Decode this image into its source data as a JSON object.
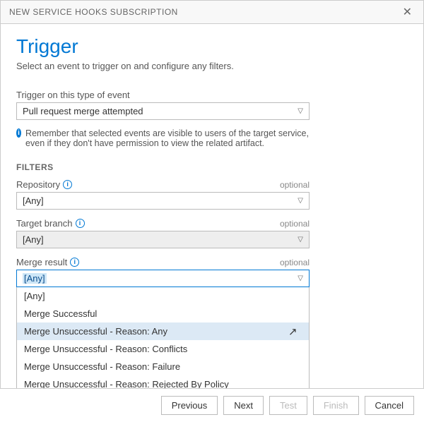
{
  "titlebar": {
    "title": "NEW SERVICE HOOKS SUBSCRIPTION"
  },
  "header": {
    "title": "Trigger",
    "subtitle": "Select an event to trigger on and configure any filters."
  },
  "event": {
    "label": "Trigger on this type of event",
    "value": "Pull request merge attempted"
  },
  "note": "Remember that selected events are visible to users of the target service, even if they don't have permission to view the related artifact.",
  "filters": {
    "heading": "FILTERS",
    "optional": "optional",
    "repository": {
      "label": "Repository",
      "value": "[Any]"
    },
    "branch": {
      "label": "Target branch",
      "value": "[Any]"
    },
    "merge": {
      "label": "Merge result",
      "value": "[Any]",
      "options": [
        "[Any]",
        "Merge Successful",
        "Merge Unsuccessful - Reason: Any",
        "Merge Unsuccessful - Reason: Conflicts",
        "Merge Unsuccessful - Reason: Failure",
        "Merge Unsuccessful - Reason: Rejected By Policy"
      ],
      "hover_index": 2
    }
  },
  "footer": {
    "previous": "Previous",
    "next": "Next",
    "test": "Test",
    "finish": "Finish",
    "cancel": "Cancel"
  }
}
